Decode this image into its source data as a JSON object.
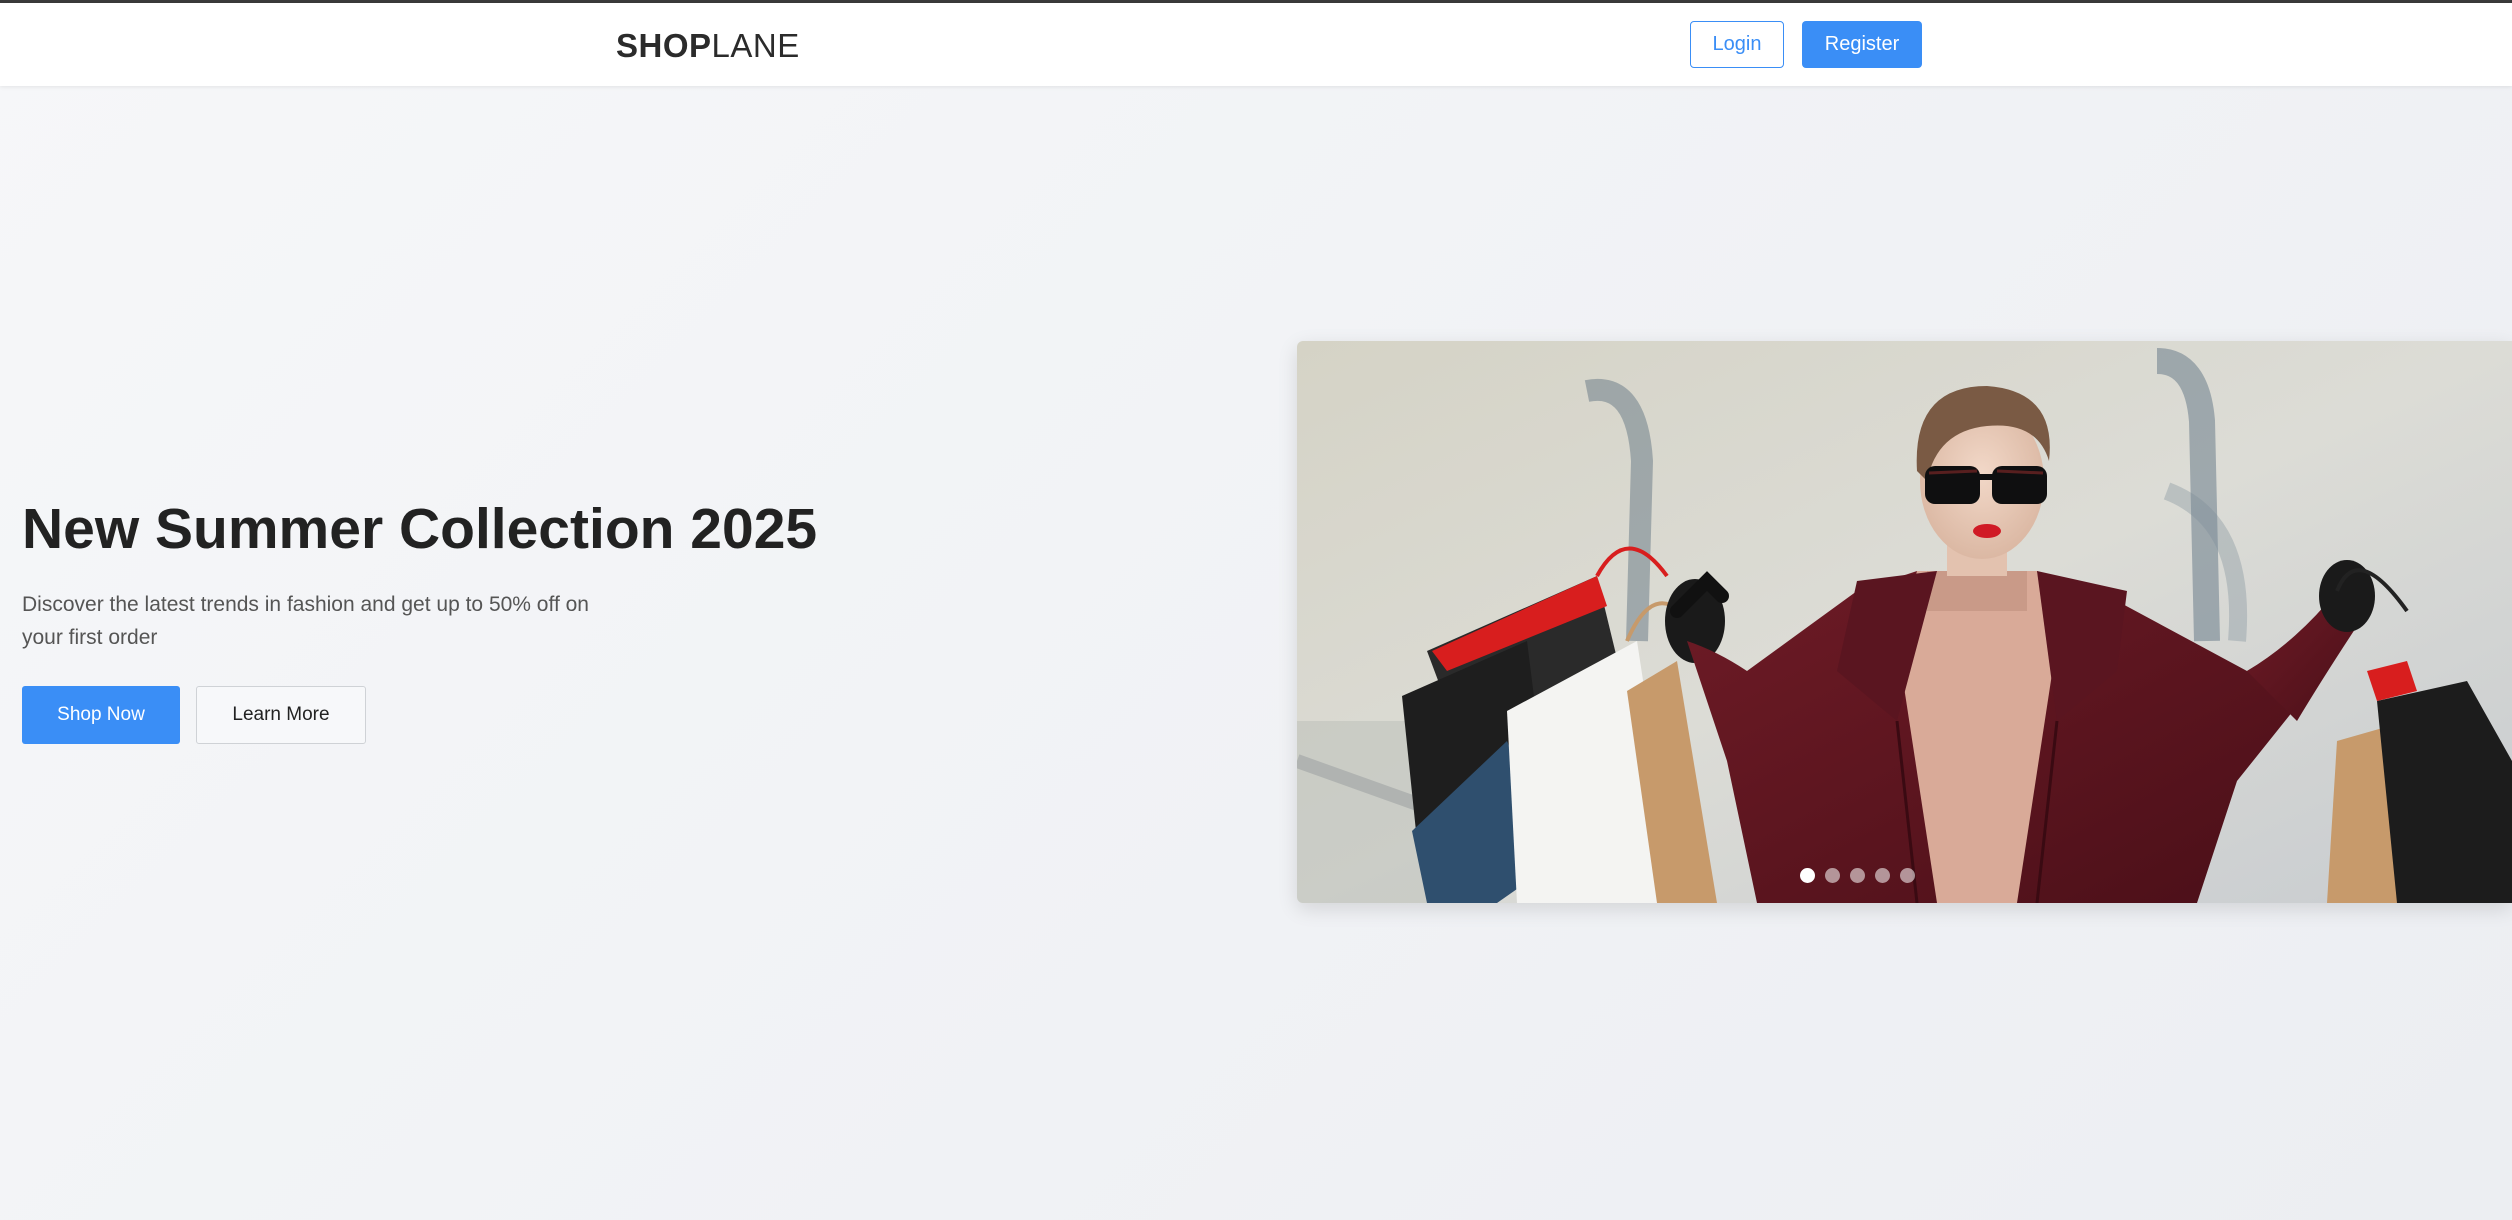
{
  "header": {
    "logo_bold": "SHOP",
    "logo_thin": "LANE",
    "login_label": "Login",
    "register_label": "Register"
  },
  "hero": {
    "title": "New Summer Collection 2025",
    "subtitle": "Discover the latest trends in fashion and get up to 50% off on your first order",
    "shop_now_label": "Shop Now",
    "learn_more_label": "Learn More"
  },
  "carousel": {
    "slide_count": 5,
    "active_index": 0
  },
  "colors": {
    "accent": "#3a8ef6",
    "text_dark": "#222222",
    "text_muted": "#555555"
  }
}
